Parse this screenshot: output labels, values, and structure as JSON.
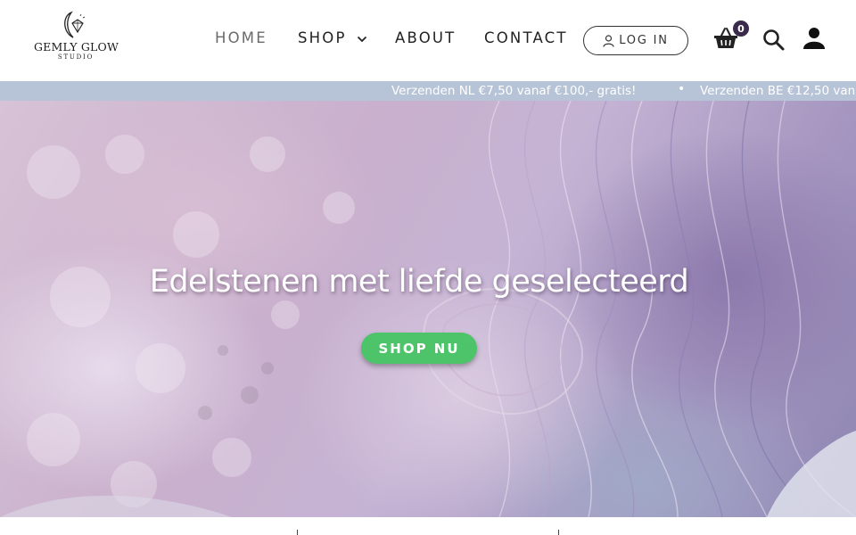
{
  "header": {
    "logo": {
      "name": "GEMLY GLOW",
      "sub": "STUDIO"
    },
    "nav": [
      {
        "label": "HOME",
        "active": true
      },
      {
        "label": "SHOP",
        "has_dropdown": true
      },
      {
        "label": "ABOUT"
      },
      {
        "label": "CONTACT"
      }
    ],
    "login_label": "LOG IN",
    "cart_count": "0",
    "icons": {
      "cart": "basket-icon",
      "search": "search-icon",
      "account": "user-icon",
      "login": "user-outline-icon",
      "dropdown": "chevron-down-icon"
    }
  },
  "announcement": {
    "items": [
      "Verzenden NL €7,50 vanaf €100,- gratis!",
      "Verzenden BE €12,50 van"
    ],
    "separator": "•",
    "bg_color": "#b7c3d6"
  },
  "hero": {
    "title": "Edelstenen met liefde geselecteerd",
    "button_label": "SHOP NU",
    "button_color": "#4ec46a"
  }
}
